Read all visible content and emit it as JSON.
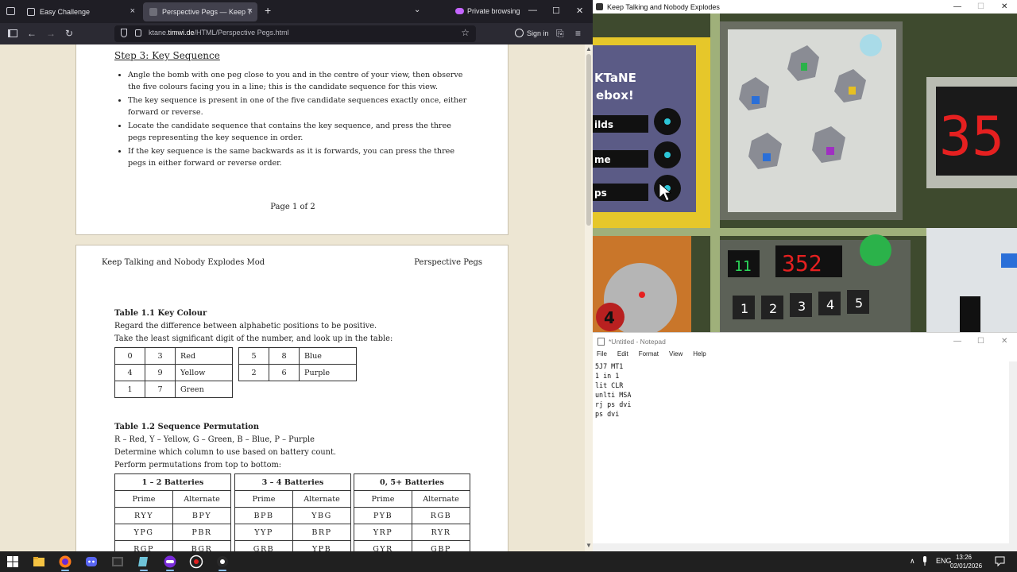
{
  "browser": {
    "tabs": [
      {
        "label": "Easy Challenge",
        "close": "×"
      },
      {
        "label": "Perspective Pegs — Keep Talking and Nobody Explodes",
        "close": "×"
      }
    ],
    "new_tab": "+",
    "tab_list": "⌄",
    "private_label": "Private browsing",
    "window_controls": {
      "min": "—",
      "max": "☐",
      "close": "✕"
    },
    "nav": {
      "back": "←",
      "forward": "→",
      "reload": "↻"
    },
    "url_prefix": "ktane.",
    "url_host": "timwi.de",
    "url_path": "/HTML/Perspective Pegs.html",
    "star": "☆",
    "sign_in": "Sign in",
    "extensions": "⎘",
    "menu": "≡"
  },
  "manual": {
    "page1": {
      "step_title": "Step 3: Key Sequence",
      "bullets": [
        "Angle the bomb with one peg close to you and in the centre of your view, then observe the five colours facing you in a line; this is the candidate sequence for this view.",
        "The key sequence is present in one of the five candidate sequences exactly once, either forward or reverse.",
        "Locate the candidate sequence that contains the key sequence, and press the three pegs representing the key sequence in order.",
        "If the key sequence is the same backwards as it is forwards, you can press the three pegs in either forward or reverse order."
      ],
      "page_number": "Page 1 of 2"
    },
    "page2": {
      "header_left": "Keep Talking and Nobody Explodes Mod",
      "header_right": "Perspective Pegs",
      "table1_title": "Table 1.1 Key Colour",
      "table1_line1": "Regard the difference between alphabetic positions to be positive.",
      "table1_line2": "Take the least significant digit of the number, and look up in the table:",
      "colour_table_left": [
        [
          "0",
          "3",
          "Red"
        ],
        [
          "4",
          "9",
          "Yellow"
        ],
        [
          "1",
          "7",
          "Green"
        ]
      ],
      "colour_table_right": [
        [
          "5",
          "8",
          "Blue"
        ],
        [
          "2",
          "6",
          "Purple"
        ]
      ],
      "table2_title": "Table 1.2 Sequence Permutation",
      "table2_line1": "R – Red, Y – Yellow, G – Green, B – Blue, P – Purple",
      "table2_line2": "Determine which column to use based on battery count.",
      "table2_line3": "Perform permutations from top to bottom:",
      "perm_groups": [
        "1 – 2 Batteries",
        "3 – 4 Batteries",
        "0, 5+ Batteries"
      ],
      "perm_sub": [
        "Prime",
        "Alternate"
      ],
      "perm_rows": [
        [
          "RYY",
          "BPY",
          "BPB",
          "YBG",
          "PYB",
          "RGB"
        ],
        [
          "YPG",
          "PBR",
          "YYP",
          "BRP",
          "YRP",
          "RYR"
        ],
        [
          "RGP",
          "BGR",
          "GRB",
          "YPB",
          "GYR",
          "GBP"
        ]
      ]
    }
  },
  "game": {
    "title": "Keep Talking and Nobody Explodes",
    "timer": "35",
    "display_value": "352",
    "small_display": "11",
    "keypad": [
      "1",
      "2",
      "3",
      "4",
      "5"
    ],
    "label_lines": [
      "KTaNE",
      "ebox!",
      "ilds",
      "me",
      "ps"
    ],
    "dial_number": "4",
    "colors": {
      "peg_red": "#d8262a",
      "peg_green": "#2bb24a",
      "peg_blue": "#2a6fd8",
      "peg_yellow": "#e6c022",
      "peg_purple": "#a02fc2"
    }
  },
  "notepad": {
    "title": "*Untitled - Notepad",
    "menu": [
      "File",
      "Edit",
      "Format",
      "View",
      "Help"
    ],
    "text": "5J7 MT1\n1 in 1\nlit CLR\nunlti MSA\nrj ps dvi\nps dvi"
  },
  "taskbar": {
    "language": "ENG",
    "time": "13:26",
    "date": "02/01/2026",
    "tray_chevron": "∧"
  }
}
